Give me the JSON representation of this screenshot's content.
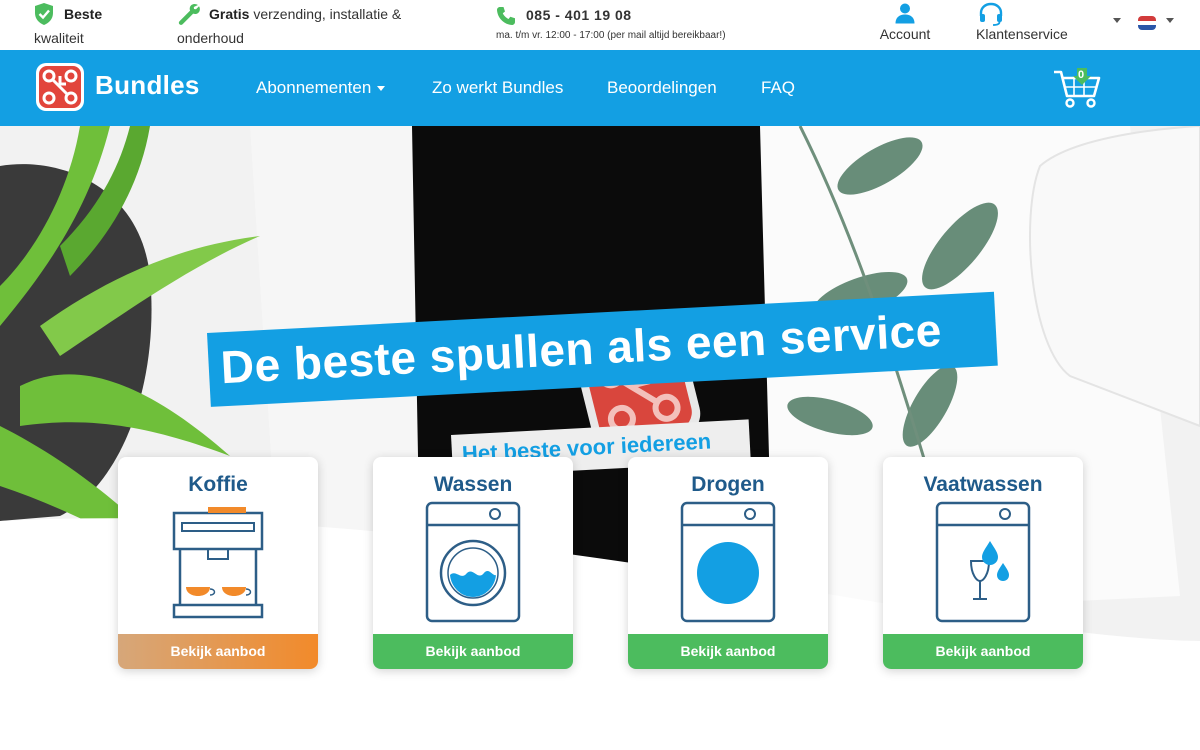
{
  "topbar": {
    "usp_quality_bold": "Beste",
    "usp_quality_rest": "kwaliteit",
    "usp_free_bold": "Gratis",
    "usp_free_rest1": "verzending, installatie &",
    "usp_free_rest2": "onderhoud",
    "phone_number": "085 - 401 19 08",
    "phone_hours": "ma. t/m vr. 12:00 - 17:00 (per mail altijd bereikbaar!)",
    "account_label": "Account",
    "service_label": "Klantenservice"
  },
  "nav": {
    "brand": "Bundles",
    "items": [
      {
        "label": "Abonnementen"
      },
      {
        "label": "Zo werkt Bundles"
      },
      {
        "label": "Beoordelingen"
      },
      {
        "label": "FAQ"
      }
    ],
    "cart_count": "0"
  },
  "hero": {
    "headline": "De beste spullen als een service",
    "subline": "Het beste voor iedereen"
  },
  "cards": [
    {
      "title": "Koffie",
      "button": "Bekijk aanbod"
    },
    {
      "title": "Wassen",
      "button": "Bekijk aanbod"
    },
    {
      "title": "Drogen",
      "button": "Bekijk aanbod"
    },
    {
      "title": "Vaatwassen",
      "button": "Bekijk aanbod"
    }
  ],
  "colors": {
    "brand_blue": "#139fe3",
    "green": "#4cbc5e",
    "orange": "#f28a2a",
    "title_blue": "#1f5a8a",
    "logo_red": "#e2453c"
  },
  "icons": [
    "shield-check-icon",
    "wrench-icon",
    "phone-icon",
    "user-icon",
    "headset-icon",
    "chevron-down-icon",
    "netherlands-flag-icon",
    "cart-icon",
    "coffee-machine-icon",
    "washing-machine-icon",
    "dryer-icon",
    "dishwasher-icon"
  ]
}
